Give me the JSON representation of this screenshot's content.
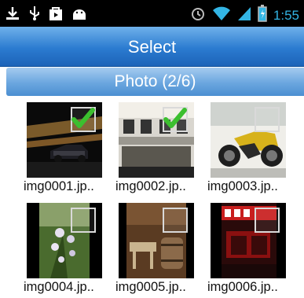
{
  "status_bar": {
    "time": "1:55",
    "icons_left": [
      "download-icon",
      "usb-icon",
      "shopping-bag-icon",
      "android-icon"
    ],
    "icons_right": [
      "alarm-icon",
      "wifi-icon",
      "signal-icon",
      "battery-icon"
    ],
    "accent": "#33b5e5"
  },
  "header": {
    "title": "Select"
  },
  "section": {
    "label": "Photo (2/6)"
  },
  "photos": [
    {
      "name": "img0001.jp..",
      "selected": true
    },
    {
      "name": "img0002.jp..",
      "selected": true
    },
    {
      "name": "img0003.jp..",
      "selected": false
    },
    {
      "name": "img0004.jp..",
      "selected": false
    },
    {
      "name": "img0005.jp..",
      "selected": false
    },
    {
      "name": "img0006.jp..",
      "selected": false
    }
  ],
  "colors": {
    "title_bar": "#2b7bd0",
    "section_bar": "#6aa6df",
    "check": "#3cbf2f"
  }
}
